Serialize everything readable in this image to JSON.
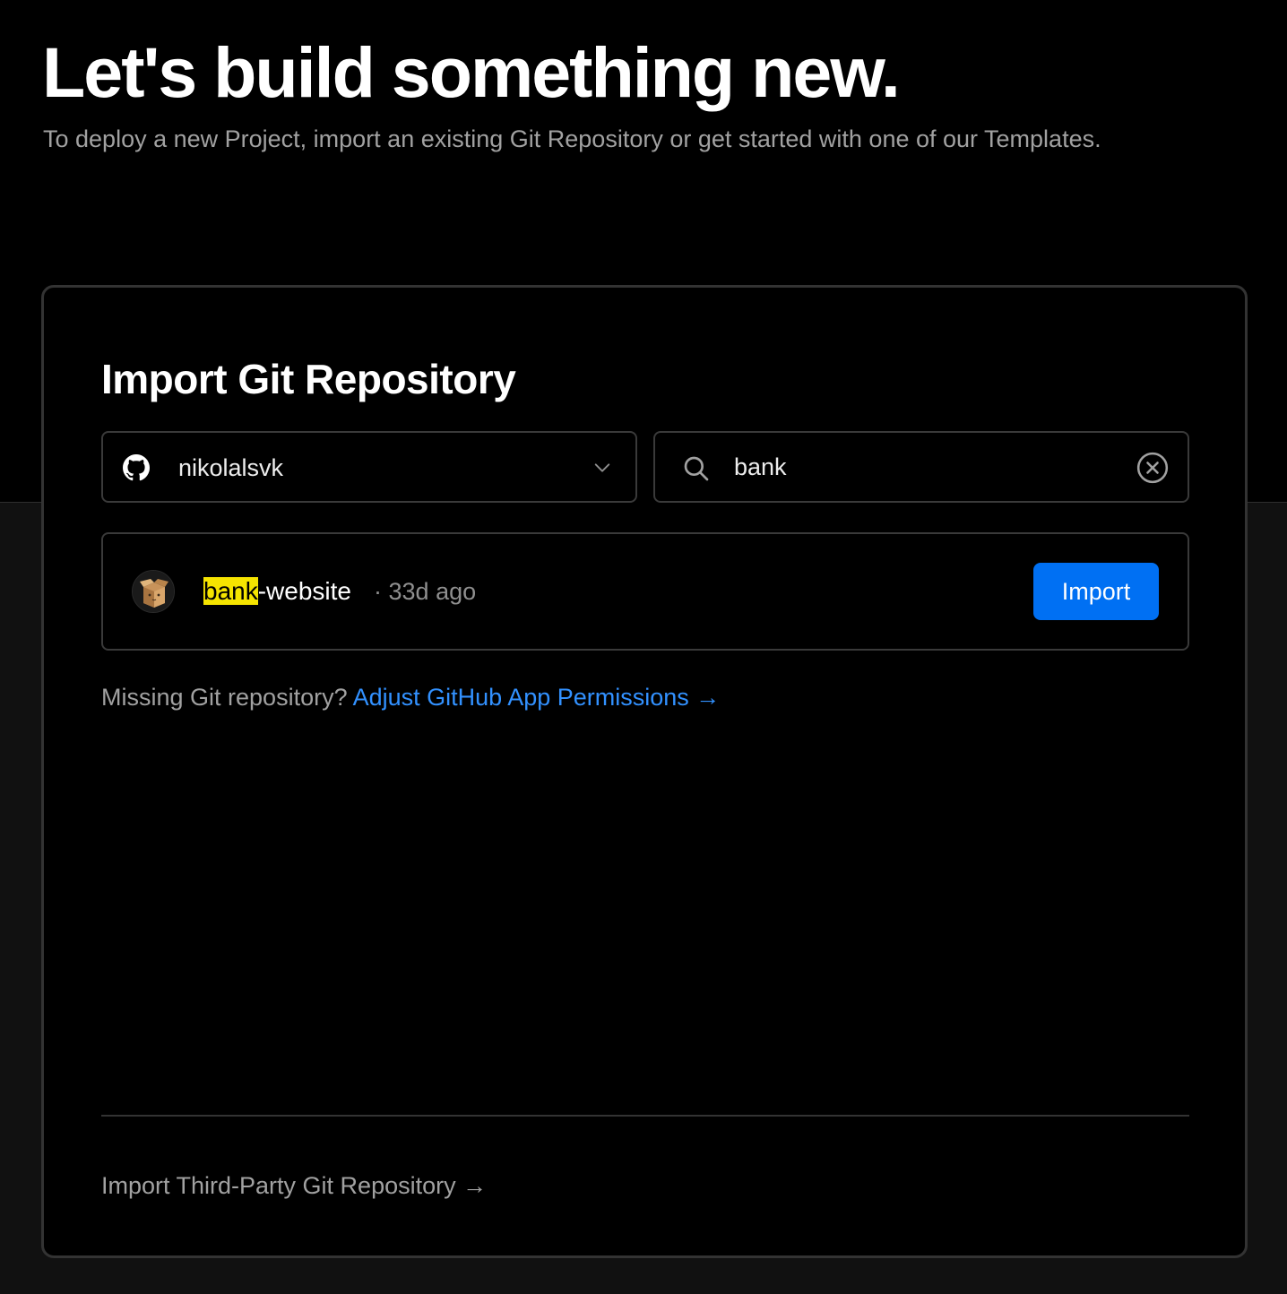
{
  "hero": {
    "title": "Let's build something new.",
    "subtitle": "To deploy a new Project, import an existing Git Repository or get started with one of our Templates."
  },
  "import_card": {
    "title": "Import Git Repository",
    "account_select": {
      "value": "nikolalsvk",
      "icon": "github-icon"
    },
    "search": {
      "value": "bank",
      "icon": "search-icon",
      "clear_icon": "clear-circle-x-icon"
    },
    "results": [
      {
        "name_match": "bank",
        "name_rest": "-website",
        "separator": "·",
        "updated": "33d ago",
        "avatar_icon": "box-avatar-icon",
        "action_label": "Import"
      }
    ],
    "missing_prompt": "Missing Git repository?",
    "permissions_link": "Adjust GitHub App Permissions →",
    "third_party_link": "Import Third-Party Git Repository →"
  },
  "colors": {
    "background": "#000000",
    "lower_background": "#111111",
    "accent_blue": "#0070f3",
    "link_blue": "#3291ff",
    "highlight": "#f5e400",
    "muted_text": "#a1a1a1"
  }
}
